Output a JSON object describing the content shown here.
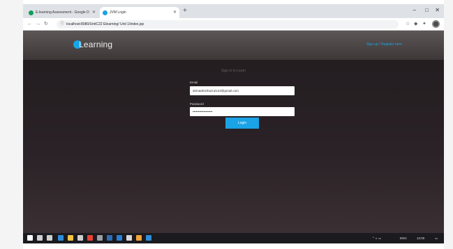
{
  "browser": {
    "tabs": [
      {
        "label": "E-learning Assessment - Google D",
        "active": false,
        "favicon_color": "#0f9d58"
      },
      {
        "label": "JVM Login",
        "active": true,
        "favicon_color": "#1aa3e6"
      }
    ],
    "new_tab_icon": "plus",
    "window_controls": {
      "minimize": "–",
      "maximize": "□",
      "close": "✕"
    },
    "address": {
      "url": "localhost:8080/UnitC22 Elearning/ Unit 1/index.jsp"
    }
  },
  "page": {
    "brand": {
      "name": "Learning",
      "accent": "#1aa3e6"
    },
    "header_link": "Sign up / Register here",
    "form": {
      "title": "Sign in to Learn",
      "email_label": "Email",
      "email_value": "ahmadminhazrul123@gmail.com",
      "password_label": "Password",
      "password_value": "••••••••••••••••••",
      "submit_label": "Login"
    }
  },
  "taskbar": {
    "items": [
      {
        "icon": "windows-start-icon",
        "color": "#ffffff"
      },
      {
        "icon": "search-icon",
        "color": "#cfcfcf"
      },
      {
        "icon": "task-view-icon",
        "color": "#cfcfcf"
      },
      {
        "icon": "edge-icon",
        "color": "#2f8cd8"
      },
      {
        "icon": "file-explorer-icon",
        "color": "#f5c342"
      },
      {
        "icon": "store-icon",
        "color": "#cfcfcf"
      },
      {
        "icon": "chrome-icon",
        "color": "#e94235"
      },
      {
        "icon": "terminal-icon",
        "color": "#9aa0a6"
      },
      {
        "icon": "netbeans-icon",
        "color": "#2f6db5"
      },
      {
        "icon": "app-icon",
        "color": "#2a7fd4"
      },
      {
        "icon": "app-icon",
        "color": "#d9d9d9"
      },
      {
        "icon": "app-icon",
        "color": "#f2a33a"
      },
      {
        "icon": "app-icon",
        "color": "#2f8cd8"
      }
    ],
    "tray": {
      "language": "ENG",
      "time": "12:00"
    }
  },
  "colors": {
    "accent": "#1aa3e6",
    "page_bg": "#221c1f",
    "taskbar_bg": "#1a1a1f"
  }
}
